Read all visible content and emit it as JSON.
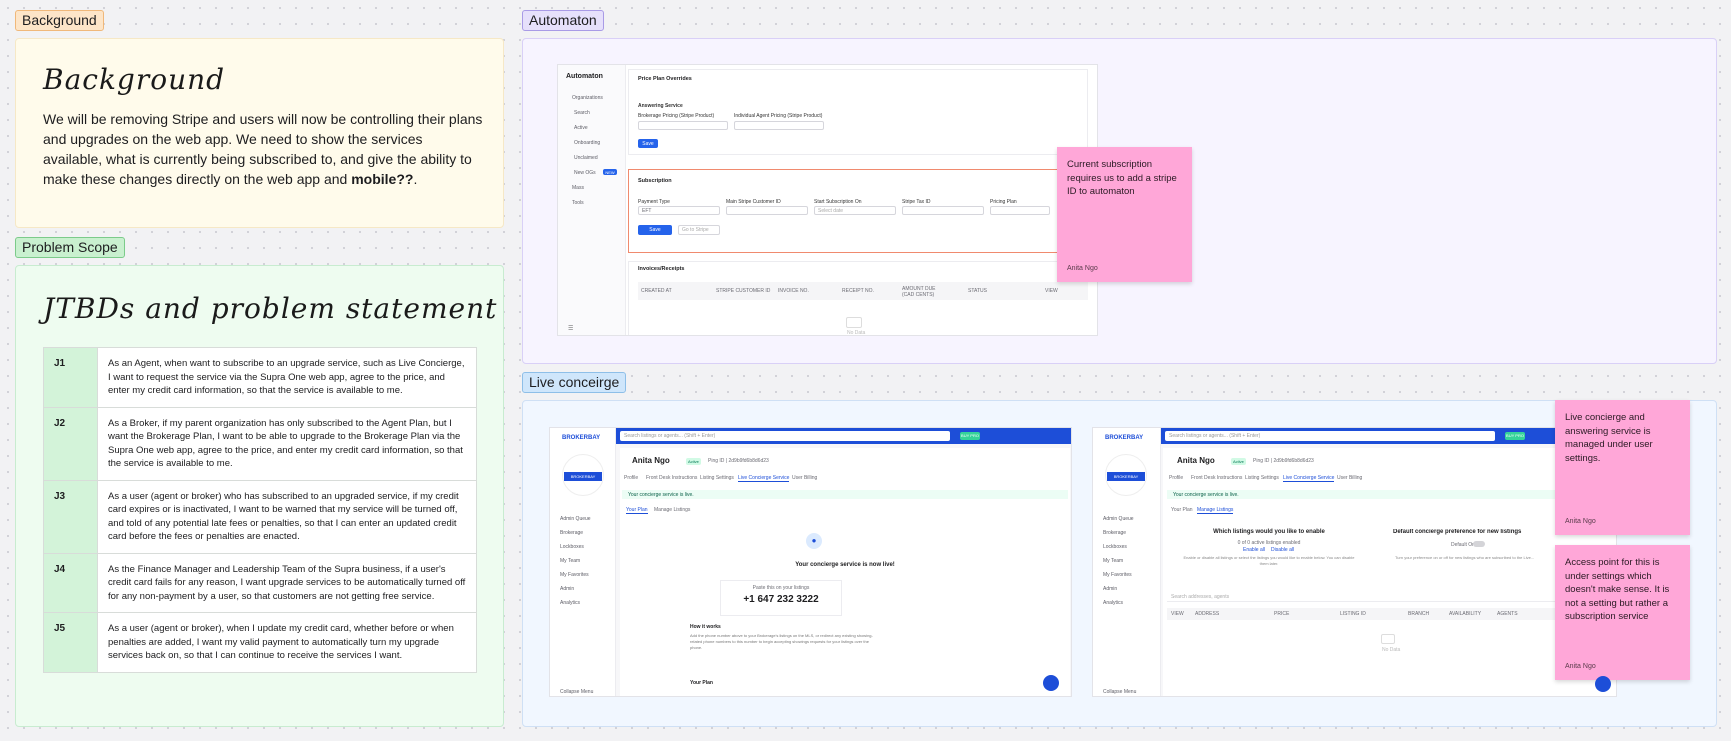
{
  "sections": {
    "background": "Background",
    "problem_scope": "Problem Scope",
    "automaton": "Automaton",
    "live_concierge": "Live conceirge"
  },
  "background": {
    "heading": "Background",
    "body_1": "We will be removing Stripe and users will now be controlling their plans and upgrades on the web app. We need to show the services available, what is currently being subscribed to, and give the ability to make these changes directly on the web app and ",
    "body_bold": "mobile??",
    "body_end": "."
  },
  "problem": {
    "heading": "JTBDs and problem statement",
    "rows": [
      {
        "id": "J1",
        "text": "As an Agent, when want to subscribe to an upgrade service, such as Live Concierge, I want to request the service via the Supra One web app, agree to the price, and enter my credit card information, so that the service is available to me."
      },
      {
        "id": "J2",
        "text": "As a Broker, if my parent organization has only subscribed to the Agent Plan, but I want the Brokerage Plan, I want to be able to upgrade to the Brokerage Plan via the Supra One web app, agree to the price, and enter my credit card information, so that the service is available to me."
      },
      {
        "id": "J3",
        "text": "As a user (agent or broker) who has subscribed to an upgraded service, if my credit card expires or is inactivated, I want to be warned that my service will be turned off, and told of any potential late fees or penalties, so that I can enter an updated credit card before the fees or penalties are enacted."
      },
      {
        "id": "J4",
        "text": "As the Finance Manager and Leadership Team of the Supra business, if a user's credit card fails for any reason, I want upgrade services to be automatically turned off for any non-payment by a user, so that customers are not getting free service."
      },
      {
        "id": "J5",
        "text": "As a user (agent or broker), when I update my credit card, whether before or when penalties are added, I want my valid payment to automatically turn my upgrade services back on, so that I can continue to receive the services I want."
      }
    ]
  },
  "automaton": {
    "app": "Automaton",
    "nav": [
      "Organizations",
      "Search",
      "Active",
      "Onboarding",
      "Unclaimed",
      "New OGs",
      "Mass",
      "Tools"
    ],
    "nav_badge": "NEW",
    "price_title": "Price Plan Overrides",
    "answering": "Answering Service",
    "brokerage_label": "Brokerage Pricing (Stripe Product)",
    "agent_label": "Individual Agent Pricing (Stripe Product)",
    "save": "Save",
    "subscription_title": "Subscription",
    "sub_fields": [
      "Payment Type",
      "Main Stripe Customer ID",
      "Start Subscription On",
      "Stripe Tax ID",
      "Pricing Plan"
    ],
    "payment_value": "EFT",
    "date_placeholder": "Select date",
    "save2": "Save",
    "edit_btn": "Go to Stripe",
    "invoices_title": "Invoices/Receipts",
    "invoice_cols": [
      "CREATED AT",
      "STRIPE CUSTOMER ID",
      "INVOICE NO.",
      "RECEIPT NO.",
      "AMOUNT DUE (CAD CENTS)",
      "STATUS",
      "VIEW"
    ],
    "no_data": "No Data",
    "sticky": "Current subscription requires us to add a stripe ID to automaton",
    "sticky_author": "Anita Ngo"
  },
  "live": {
    "brand": "BROKERBAY",
    "search_placeholder": "Search listings or agents... (Shift + Enter)",
    "badge": "BUY PRO",
    "side_nav": [
      "Admin Queue",
      "Brokerage",
      "Lockboxes",
      "My Team",
      "My Favorites",
      "Admin",
      "Analytics"
    ],
    "collapse": "Collapse Menu",
    "profile_name": "Anita Ngo",
    "profile_status": "Active",
    "profile_meta": "Ping ID | 2d9b9fd6b8d6d23",
    "tabs": [
      "Profile",
      "Front Desk Instructions",
      "Listing Settings",
      "Live Concierge Service",
      "User Billing"
    ],
    "alert": "Your concierge service is live.",
    "subtabs": [
      "Your Plan",
      "Manage Listings"
    ],
    "live_title": "Your concierge service is now live!",
    "phone_caption": "Paste this on your listings",
    "phone": "+1 647 232 3222",
    "how_title": "How it works",
    "how_text": "Add the phone number above to your Brokerage's listings on the MLS, or redirect any existing showing-related phone numbers to this number to begin accepting showings requests for your listings over the phone.",
    "plan_title": "Your Plan",
    "enable_title": "Which listings would you like to enable",
    "enable_count": "0 of 0 active listings enabled",
    "enable_all": "Enable all",
    "disable_all": "Disable all",
    "enable_help": "Enable or disable all listings or select the listings you would like to enable below. You can disable them later.",
    "default_title": "Default concierge preference for new listings",
    "default_on": "Default On",
    "default_help": "Turn your preference on or off for new listings who are subscribed to the Live...",
    "search2": "Search addresses, agents",
    "grid_cols": [
      "VIEW",
      "ADDRESS",
      "PRICE",
      "LISTING ID",
      "BRANCH",
      "AVAILABILITY",
      "AGENTS"
    ],
    "no_data": "No Data",
    "sticky1": "Live concierge and answering service is managed under user settings.",
    "sticky1_author": "Anita Ngo",
    "sticky2": "Access point for this is under settings which doesn't make sense. It is not a setting but rather a subscription service",
    "sticky2_author": "Anita Ngo"
  },
  "colors": {
    "sticky": "#ffa7d8",
    "accent": "#1d4ed8",
    "alert_red": "#f08a6e"
  }
}
